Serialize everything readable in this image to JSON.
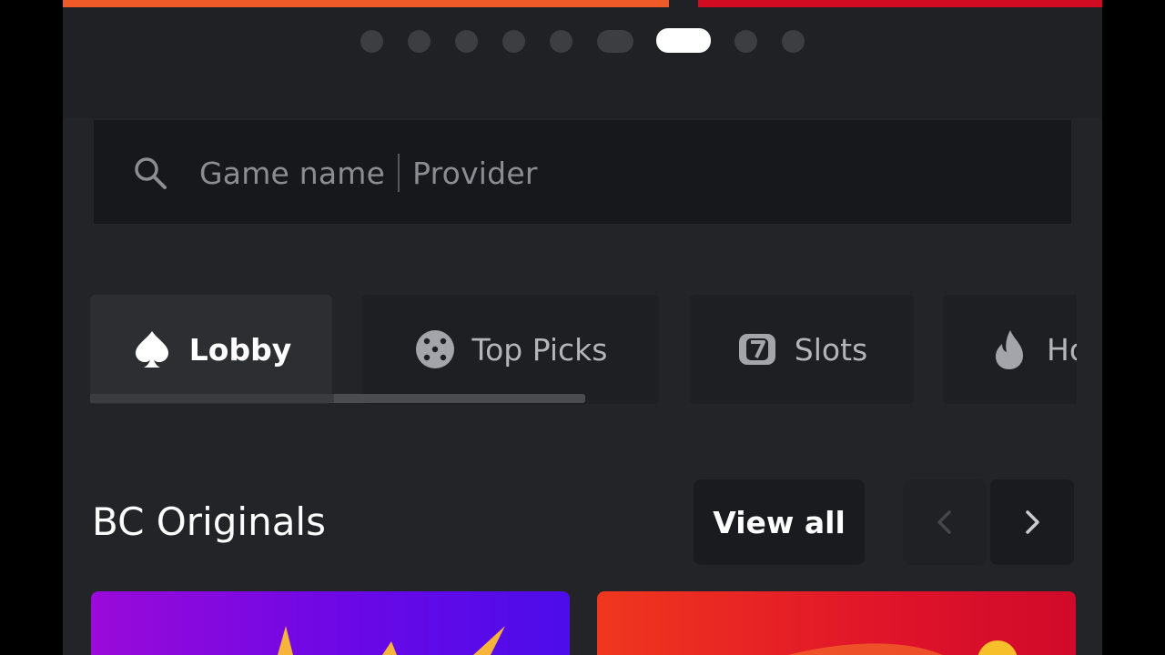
{
  "colors": {
    "banner_left": "#f05a28",
    "banner_right": "#d10b22",
    "background": "#232427",
    "search_bg": "#17181b",
    "active_dot": "#ffffff"
  },
  "carousel": {
    "dot_count": 9,
    "active_index": 6
  },
  "search": {
    "icon": "search-icon",
    "placeholder_name": "Game name",
    "placeholder_provider": "Provider"
  },
  "tabs": [
    {
      "label": "Lobby",
      "icon": "spade-icon",
      "active": true
    },
    {
      "label": "Top Picks",
      "icon": "dice-icon",
      "active": false
    },
    {
      "label": "Slots",
      "icon": "slot-seven-icon",
      "active": false
    },
    {
      "label": "Ho",
      "icon": "flame-icon",
      "active": false
    }
  ],
  "section": {
    "title": "BC Originals",
    "view_all_label": "View all",
    "prev_icon": "chevron-left-icon",
    "next_icon": "chevron-right-icon"
  },
  "cards": [
    {
      "name": "original-game-card-1",
      "color": "#7a0ae2"
    },
    {
      "name": "original-game-card-2",
      "color": "#e0142a"
    }
  ]
}
